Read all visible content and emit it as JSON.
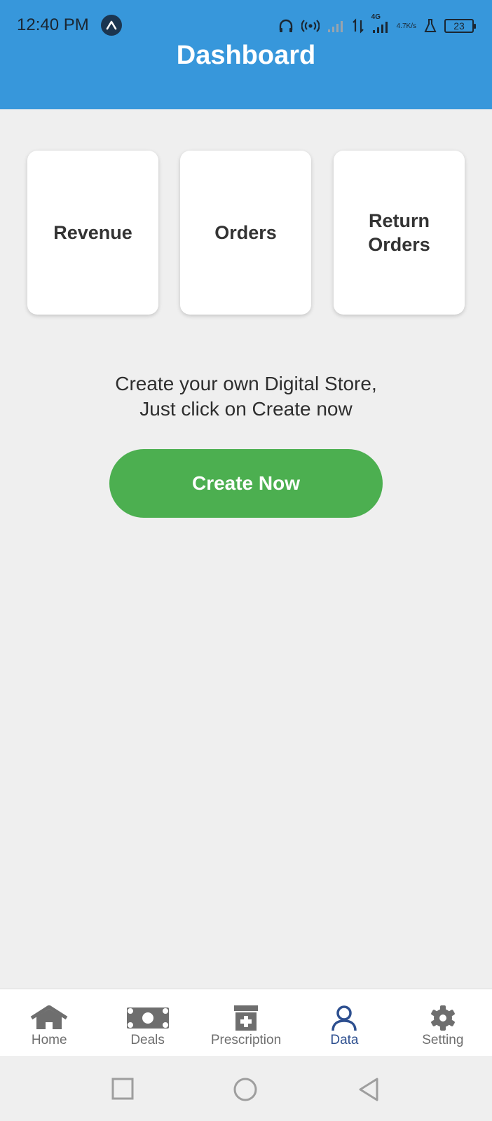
{
  "status_bar": {
    "time": "12:40 PM",
    "network": "4G",
    "speed_value": "4.7",
    "speed_unit": "K/s",
    "battery": "23"
  },
  "header": {
    "title": "Dashboard"
  },
  "cards": [
    {
      "label": "Revenue"
    },
    {
      "label": "Orders"
    },
    {
      "label": "Return Orders"
    }
  ],
  "promo": {
    "line1": "Create your own Digital Store,",
    "line2": "Just click on Create now"
  },
  "create_button": {
    "label": "Create Now"
  },
  "bottom_nav": {
    "active": "Data",
    "active_color": "#2d4f8f",
    "items": [
      {
        "label": "Home",
        "icon": "home-icon"
      },
      {
        "label": "Deals",
        "icon": "money-icon"
      },
      {
        "label": "Prescription",
        "icon": "pharmacy-icon"
      },
      {
        "label": "Data",
        "icon": "user-icon"
      },
      {
        "label": "Setting",
        "icon": "gear-icon"
      }
    ]
  },
  "colors": {
    "header": "#3797db",
    "background": "#efefef",
    "button": "#4caf50",
    "card": "#ffffff"
  }
}
